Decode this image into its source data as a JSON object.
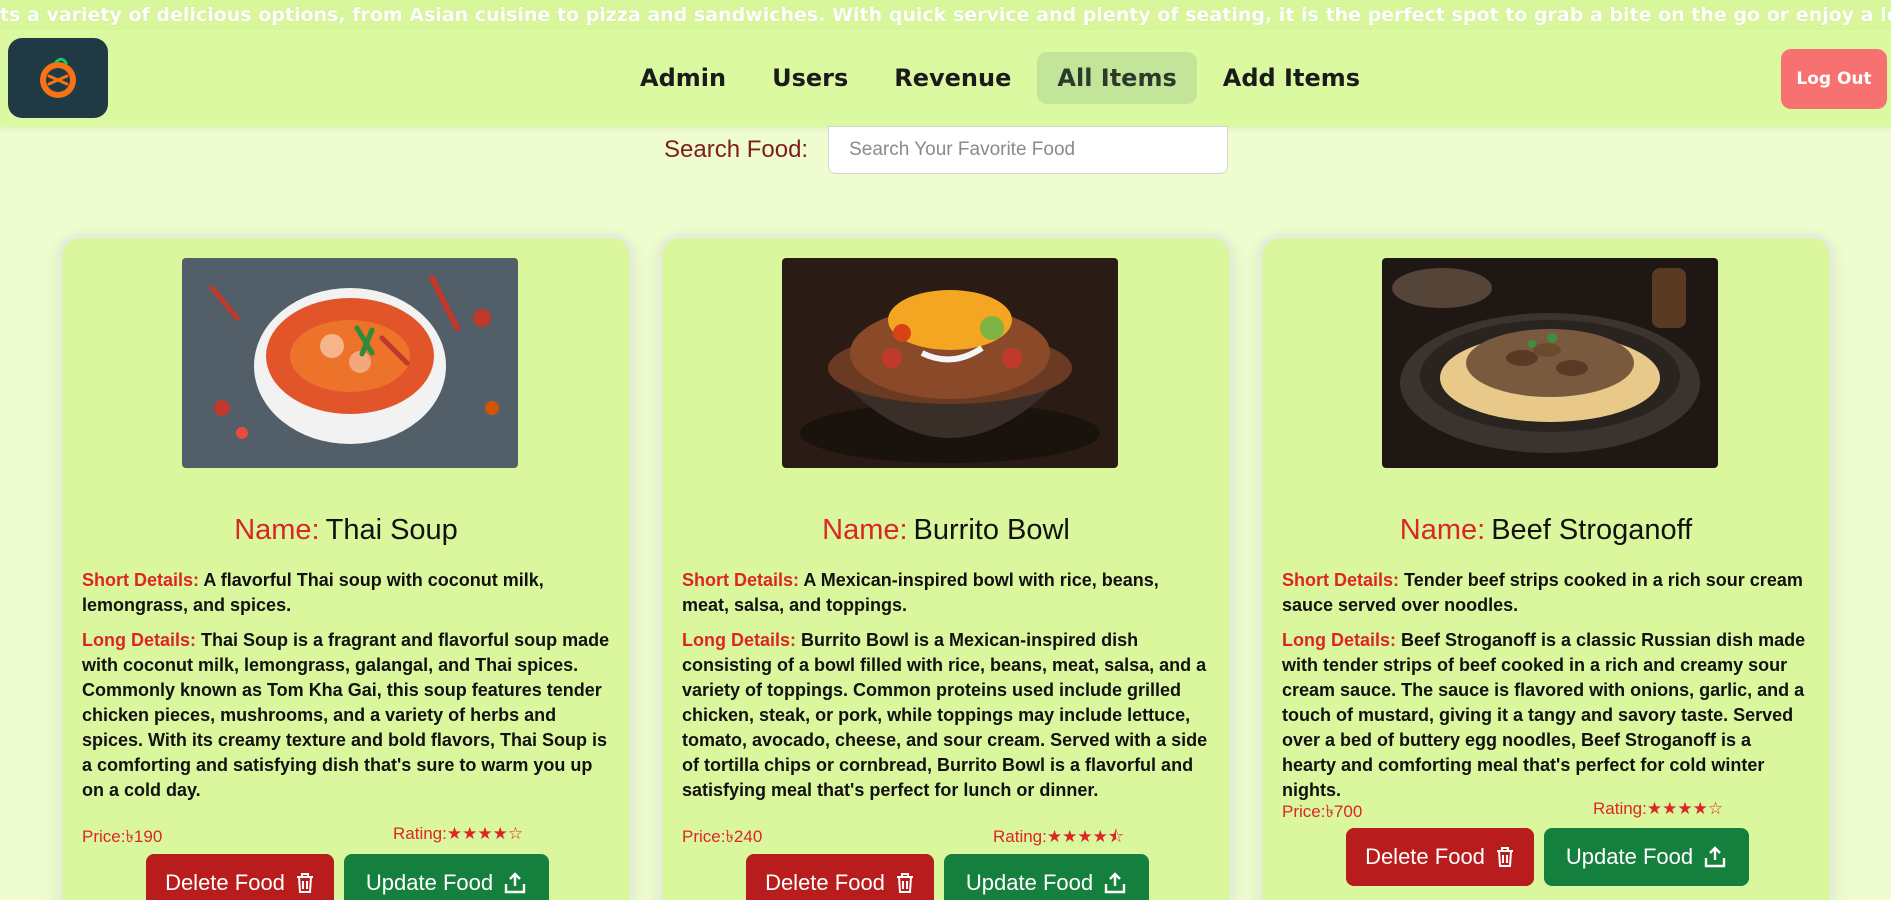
{
  "banner": {
    "text": "ts a variety of delicious options, from Asian cuisine to pizza and sandwiches. With quick service and plenty of seating, it is the perfect spot to grab a bite on the go or enjoy a leisurely meal with friends and fam"
  },
  "nav": {
    "links": [
      "Admin",
      "Users",
      "Revenue",
      "All Items",
      "Add Items"
    ],
    "active": "All Items",
    "logout_label": "Log Out"
  },
  "search": {
    "label": "Search Food:",
    "placeholder": "Search Your Favorite Food",
    "value": ""
  },
  "labels": {
    "name": "Name:",
    "short_details": "Short Details:",
    "long_details": "Long Details:",
    "price": "Price:",
    "rating": "Rating:",
    "delete_button": "Delete Food",
    "update_button": "Update Food"
  },
  "items": [
    {
      "name": "Thai Soup",
      "short_details": "A flavorful Thai soup with coconut milk, lemongrass, and spices.",
      "long_details": "Thai Soup is a fragrant and flavorful soup made with coconut milk, lemongrass, galangal, and Thai spices. Commonly known as Tom Kha Gai, this soup features tender chicken pieces, mushrooms, and a variety of herbs and spices. With its creamy texture and bold flavors, Thai Soup is a comforting and satisfying dish that's sure to warm you up on a cold day.",
      "price": "৳190",
      "rating": 4,
      "rating_max": 5
    },
    {
      "name": "Burrito Bowl",
      "short_details": "A Mexican-inspired bowl with rice, beans, meat, salsa, and toppings.",
      "long_details": "Burrito Bowl is a Mexican-inspired dish consisting of a bowl filled with rice, beans, meat, salsa, and a variety of toppings. Common proteins used include grilled chicken, steak, or pork, while toppings may include lettuce, tomato, avocado, cheese, and sour cream. Served with a side of tortilla chips or cornbread, Burrito Bowl is a flavorful and satisfying meal that's perfect for lunch or dinner.",
      "price": "৳240",
      "rating": 4.5,
      "rating_max": 5
    },
    {
      "name": "Beef Stroganoff",
      "short_details": "Tender beef strips cooked in a rich sour cream sauce served over noodles.",
      "long_details": "Beef Stroganoff is a classic Russian dish made with tender strips of beef cooked in a rich and creamy sour cream sauce. The sauce is flavored with onions, garlic, and a touch of mustard, giving it a tangy and savory taste. Served over a bed of buttery egg noodles, Beef Stroganoff is a hearty and comforting meal that's perfect for cold winter nights.",
      "price": "৳700",
      "rating": 4,
      "rating_max": 5
    }
  ],
  "colors": {
    "navbar": "#dbf9a0",
    "accent_red": "#dc2626",
    "delete": "#b91c1c",
    "update": "#15803d",
    "logout": "#f87171"
  }
}
